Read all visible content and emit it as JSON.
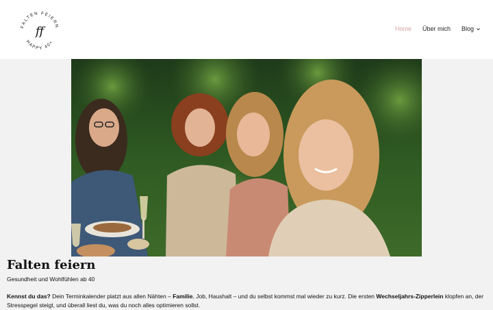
{
  "logo": {
    "top_text": "FALTEN FEIERN",
    "bottom_text": "HAPPY 40+",
    "monogram": "ff"
  },
  "nav": {
    "items": [
      {
        "label": "Home"
      },
      {
        "label": "Über mich"
      },
      {
        "label": "Blog"
      }
    ],
    "accent": "#d6a3a3"
  },
  "hero": {
    "subject": "group-of-smiling-women-at-outdoor-table"
  },
  "main": {
    "title": "Falten feiern",
    "subtitle": "Gesundheit und Wohlfühlen ab 40",
    "intro": {
      "p1": "Kennst du das?",
      "p2": " Dein Terminkalender platzt aus allen Nähten – ",
      "p3": "Familie",
      "p4": ", Job, Haushalt – und du selbst kommst mal wieder zu kurz. Die ersten ",
      "p5": "Wechseljahrs-Zipperlein",
      "p6": " klopfen an, der Stresspegel steigt, und überall liest du, was du noch alles optimieren sollst."
    }
  }
}
